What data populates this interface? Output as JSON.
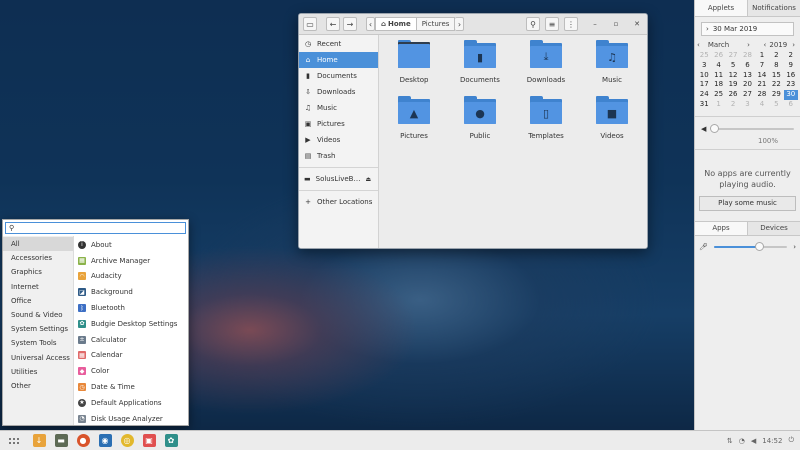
{
  "file_manager": {
    "breadcrumbs": [
      "Home",
      "Pictures"
    ],
    "sidebar": [
      {
        "label": "Recent",
        "icon": "clock-icon",
        "glyph": "◷",
        "active": false
      },
      {
        "label": "Home",
        "icon": "home-icon",
        "glyph": "⌂",
        "active": true
      },
      {
        "label": "Documents",
        "icon": "document-icon",
        "glyph": "▮",
        "active": false
      },
      {
        "label": "Downloads",
        "icon": "download-icon",
        "glyph": "⇩",
        "active": false
      },
      {
        "label": "Music",
        "icon": "music-icon",
        "glyph": "♫",
        "active": false
      },
      {
        "label": "Pictures",
        "icon": "picture-icon",
        "glyph": "▣",
        "active": false
      },
      {
        "label": "Videos",
        "icon": "video-icon",
        "glyph": "▶",
        "active": false
      },
      {
        "label": "Trash",
        "icon": "trash-icon",
        "glyph": "▤",
        "active": false
      }
    ],
    "drive": "SolusLiveB…",
    "other_locations": "Other Locations",
    "files": [
      {
        "name": "Desktop",
        "icon": "desktop-folder-icon",
        "glyph": ""
      },
      {
        "name": "Documents",
        "icon": "documents-folder-icon",
        "glyph": "▮"
      },
      {
        "name": "Downloads",
        "icon": "downloads-folder-icon",
        "glyph": "⤓"
      },
      {
        "name": "Music",
        "icon": "music-folder-icon",
        "glyph": "♫"
      },
      {
        "name": "Pictures",
        "icon": "pictures-folder-icon",
        "glyph": "▲"
      },
      {
        "name": "Public",
        "icon": "public-folder-icon",
        "glyph": "●"
      },
      {
        "name": "Templates",
        "icon": "templates-folder-icon",
        "glyph": "▯"
      },
      {
        "name": "Videos",
        "icon": "videos-folder-icon",
        "glyph": "■"
      }
    ]
  },
  "panel": {
    "tabs": [
      "Applets",
      "Notifications"
    ],
    "date": "30 Mar 2019",
    "calendar": {
      "month": "March",
      "year": "2019",
      "days": [
        {
          "d": "25",
          "muted": true
        },
        {
          "d": "26",
          "muted": true
        },
        {
          "d": "27",
          "muted": true
        },
        {
          "d": "28",
          "muted": true
        },
        {
          "d": "1"
        },
        {
          "d": "2"
        },
        {
          "d": "2"
        },
        {
          "d": "3"
        },
        {
          "d": "4"
        },
        {
          "d": "5"
        },
        {
          "d": "6"
        },
        {
          "d": "7"
        },
        {
          "d": "8"
        },
        {
          "d": "9"
        },
        {
          "d": "10"
        },
        {
          "d": "11"
        },
        {
          "d": "12"
        },
        {
          "d": "13"
        },
        {
          "d": "14"
        },
        {
          "d": "15"
        },
        {
          "d": "16"
        },
        {
          "d": "17"
        },
        {
          "d": "18"
        },
        {
          "d": "19"
        },
        {
          "d": "20"
        },
        {
          "d": "21"
        },
        {
          "d": "22"
        },
        {
          "d": "23"
        },
        {
          "d": "24"
        },
        {
          "d": "25"
        },
        {
          "d": "26"
        },
        {
          "d": "27"
        },
        {
          "d": "28"
        },
        {
          "d": "29"
        },
        {
          "d": "30",
          "selected": true
        },
        {
          "d": "31"
        },
        {
          "d": "1",
          "muted": true
        },
        {
          "d": "2",
          "muted": true
        },
        {
          "d": "3",
          "muted": true
        },
        {
          "d": "4",
          "muted": true
        },
        {
          "d": "5",
          "muted": true
        },
        {
          "d": "6",
          "muted": true
        }
      ]
    },
    "volume_percent": "100%",
    "volume_level": 0.02,
    "no_apps_text": "No apps are currently playing audio.",
    "play_button": "Play some music",
    "device_tabs": [
      "Apps",
      "Devices"
    ],
    "mic_level": 0.62
  },
  "menu": {
    "search_placeholder": "",
    "categories": [
      {
        "label": "All",
        "active": true
      },
      {
        "label": "Accessories"
      },
      {
        "label": "Graphics"
      },
      {
        "label": "Internet"
      },
      {
        "label": "Office"
      },
      {
        "label": "Sound & Video"
      },
      {
        "label": "System Settings"
      },
      {
        "label": "System Tools"
      },
      {
        "label": "Universal Access"
      },
      {
        "label": "Utilities"
      },
      {
        "label": "Other"
      }
    ],
    "apps": [
      {
        "label": "About",
        "icon": "info-icon",
        "color": "#333333",
        "glyph": "i"
      },
      {
        "label": "Archive Manager",
        "icon": "archive-icon",
        "color": "#8bb34a",
        "glyph": "▦"
      },
      {
        "label": "Audacity",
        "icon": "audacity-icon",
        "color": "#e9a33b",
        "glyph": "◠"
      },
      {
        "label": "Background",
        "icon": "background-icon",
        "color": "#2f5a86",
        "glyph": "◪"
      },
      {
        "label": "Bluetooth",
        "icon": "bluetooth-icon",
        "color": "#3d6fc4",
        "glyph": "ᛒ"
      },
      {
        "label": "Budgie Desktop Settings",
        "icon": "budgie-icon",
        "color": "#2f8f8a",
        "glyph": "✿"
      },
      {
        "label": "Calculator",
        "icon": "calculator-icon",
        "color": "#6b7b8c",
        "glyph": "±"
      },
      {
        "label": "Calendar",
        "icon": "calendar-icon",
        "color": "#e06a6a",
        "glyph": "▦"
      },
      {
        "label": "Color",
        "icon": "color-icon",
        "color": "#e85d9c",
        "glyph": "◆"
      },
      {
        "label": "Date & Time",
        "icon": "clock-icon",
        "color": "#e8883a",
        "glyph": "◷"
      },
      {
        "label": "Default Applications",
        "icon": "star-icon",
        "color": "#444444",
        "glyph": "★"
      },
      {
        "label": "Disk Usage Analyzer",
        "icon": "disk-usage-icon",
        "color": "#7a8591",
        "glyph": "◔"
      }
    ]
  },
  "taskbar": {
    "apps": [
      {
        "name": "downloads",
        "icon": "download-icon",
        "color": "#e8a33b",
        "glyph": "↓"
      },
      {
        "name": "file-manager",
        "icon": "file-manager-icon",
        "color": "#5d6a55",
        "glyph": "▬"
      },
      {
        "name": "firefox",
        "icon": "firefox-icon",
        "color": "#d9542b",
        "glyph": "●"
      },
      {
        "name": "software-center",
        "icon": "software-center-icon",
        "color": "#2b6fb3",
        "glyph": "◉"
      },
      {
        "name": "rhythmbox",
        "icon": "rhythmbox-icon",
        "color": "#e2b82d",
        "glyph": "◎"
      },
      {
        "name": "photos",
        "icon": "photos-icon",
        "color": "#e04f4f",
        "glyph": "▣"
      },
      {
        "name": "budgie-settings",
        "icon": "budgie-icon",
        "color": "#2f8f8a",
        "glyph": "✿"
      }
    ],
    "time": "14:52"
  }
}
